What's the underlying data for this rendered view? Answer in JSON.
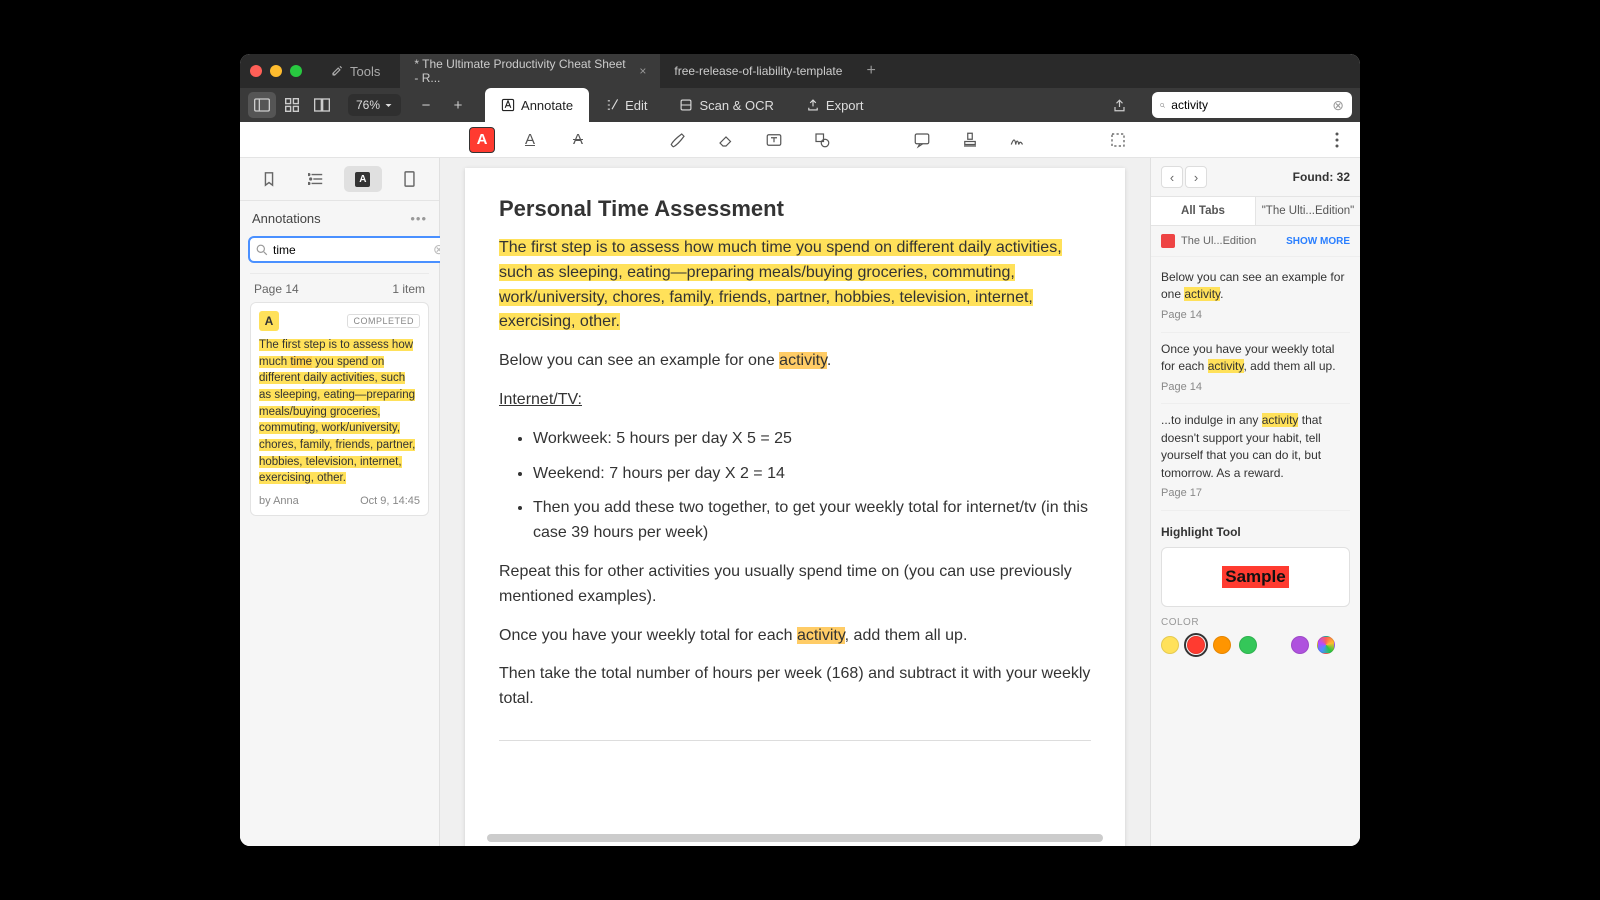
{
  "titlebar": {
    "tools_label": "Tools",
    "tabs": [
      {
        "label": "* The Ultimate Productivity Cheat Sheet - R...",
        "active": true
      },
      {
        "label": "free-release-of-liability-template",
        "active": false
      }
    ]
  },
  "toolbar": {
    "zoom": "76%",
    "modes": {
      "annotate": "Annotate",
      "edit": "Edit",
      "scan": "Scan & OCR",
      "export": "Export"
    },
    "search_value": "activity"
  },
  "left": {
    "title": "Annotations",
    "search_value": "time",
    "page_label": "Page 14",
    "page_count": "1 item",
    "card": {
      "status": "COMPLETED",
      "text_parts": [
        "The first step is to assess how much ",
        "time",
        " you spend on different daily activities, such as sleeping, eating—preparing meals/buying groceries, commuting, work/university, chores, family, friends, partner, hobbies, television, internet, exercising, other."
      ],
      "author": "by Anna",
      "timestamp": "Oct 9, 14:45"
    }
  },
  "doc": {
    "heading": "Personal Time Assessment",
    "p1_highlighted": "The first step is to assess how much time you spend on different daily activities, such as sleeping, eating—preparing meals/buying groceries, commuting, work/university, chores, family, friends, partner, hobbies, television, internet, exercising, other.",
    "p2_prefix": "Below you can see an example for one ",
    "p2_hl": "activity",
    "p2_suffix": ".",
    "subhead": "Internet/TV:",
    "li1": "Workweek: 5 hours per day X 5 = 25",
    "li2": "Weekend: 7 hours per day X 2 = 14",
    "li3": "Then you add these two together, to get your weekly total for internet/tv (in this case 39 hours per week)",
    "p3": "Repeat this for other activities you usually spend time on (you can use previously mentioned examples).",
    "p4_prefix": "Once you have your weekly total for each ",
    "p4_hl": "activity",
    "p4_suffix": ", add them all up.",
    "p5": "Then take the total number of hours per week (168) and subtract it with your weekly total."
  },
  "right": {
    "found": "Found: 32",
    "tab_all": "All Tabs",
    "tab_doc": "\"The Ulti...Edition\"",
    "source": "The Ul...Edition",
    "show_more": "SHOW MORE",
    "results": [
      {
        "pre": "Below you can see an example for one ",
        "hl": "activity",
        "post": ".",
        "page": "Page 14"
      },
      {
        "pre": "Once you have your weekly total for each ",
        "hl": "activity",
        "post": ", add them all up.",
        "page": "Page 14"
      },
      {
        "pre": "...to indulge in any ",
        "hl": "activity",
        "post": " that doesn't support your habit, tell yourself that you can do it, but tomorrow. As a reward.",
        "page": "Page 17"
      }
    ],
    "highlight_title": "Highlight Tool",
    "sample": "Sample",
    "color_label": "COLOR",
    "colors": [
      "#ffe15a",
      "#ff3b30",
      "#ff9500",
      "#34c759",
      "#af52de"
    ]
  }
}
